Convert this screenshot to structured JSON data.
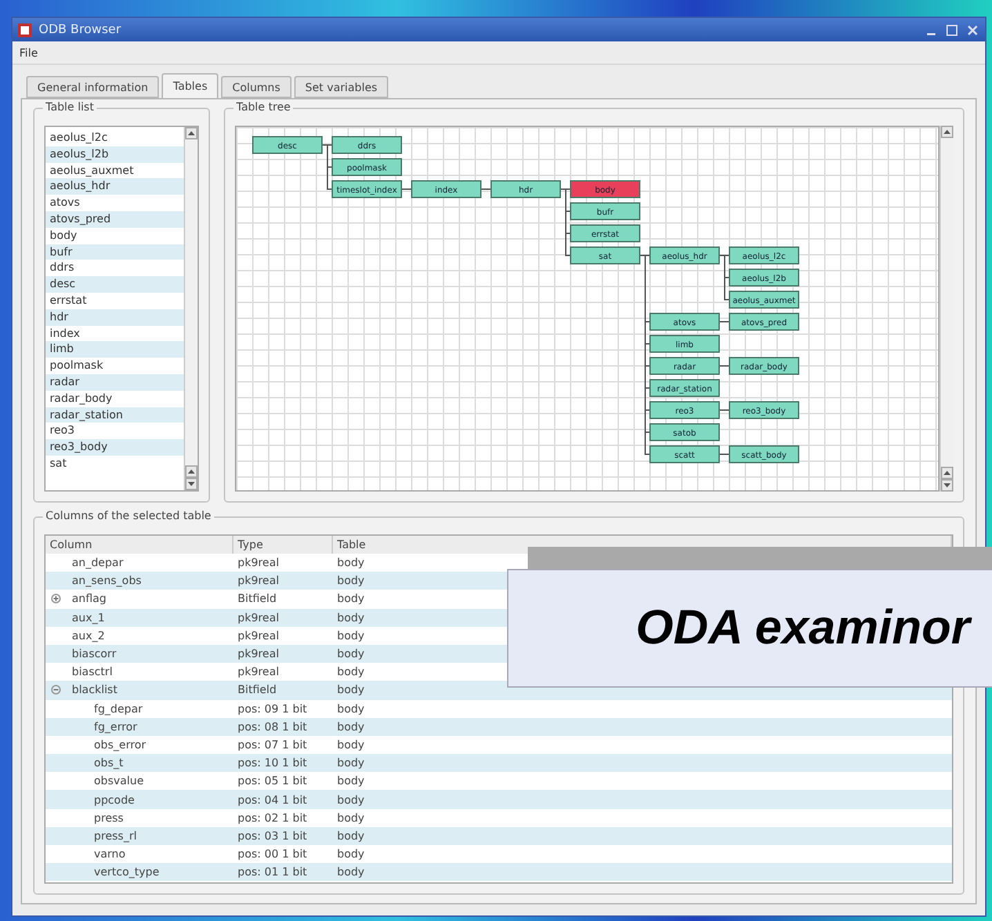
{
  "window": {
    "title": "ODB Browser"
  },
  "menu": [
    "File"
  ],
  "tabs": [
    {
      "label": "General information",
      "selected": false
    },
    {
      "label": "Tables",
      "selected": true
    },
    {
      "label": "Columns",
      "selected": false
    },
    {
      "label": "Set variables",
      "selected": false
    }
  ],
  "table_list": {
    "title": "Table list",
    "items": [
      "aeolus_l2c",
      "aeolus_l2b",
      "aeolus_auxmet",
      "aeolus_hdr",
      "atovs",
      "atovs_pred",
      "body",
      "bufr",
      "ddrs",
      "desc",
      "errstat",
      "hdr",
      "index",
      "limb",
      "poolmask",
      "radar",
      "radar_body",
      "radar_station",
      "reo3",
      "reo3_body",
      "sat"
    ]
  },
  "table_tree": {
    "title": "Table tree",
    "root": {
      "label": "desc",
      "selected": false,
      "children": [
        {
          "label": "ddrs",
          "selected": false
        },
        {
          "label": "poolmask",
          "selected": false
        },
        {
          "label": "timeslot_index",
          "selected": false,
          "children": [
            {
              "label": "index",
              "selected": false,
              "children": [
                {
                  "label": "hdr",
                  "selected": false,
                  "children": [
                    {
                      "label": "body",
                      "selected": true
                    },
                    {
                      "label": "bufr",
                      "selected": false
                    },
                    {
                      "label": "errstat",
                      "selected": false
                    },
                    {
                      "label": "sat",
                      "selected": false,
                      "children": [
                        {
                          "label": "aeolus_hdr",
                          "selected": false,
                          "children": [
                            {
                              "label": "aeolus_l2c",
                              "selected": false
                            },
                            {
                              "label": "aeolus_l2b",
                              "selected": false
                            },
                            {
                              "label": "aeolus_auxmet",
                              "selected": false
                            }
                          ]
                        },
                        {
                          "label": "atovs",
                          "selected": false,
                          "children": [
                            {
                              "label": "atovs_pred",
                              "selected": false
                            }
                          ]
                        },
                        {
                          "label": "limb",
                          "selected": false
                        },
                        {
                          "label": "radar",
                          "selected": false,
                          "children": [
                            {
                              "label": "radar_body",
                              "selected": false
                            }
                          ]
                        },
                        {
                          "label": "radar_station",
                          "selected": false
                        },
                        {
                          "label": "reo3",
                          "selected": false,
                          "children": [
                            {
                              "label": "reo3_body",
                              "selected": false
                            }
                          ]
                        },
                        {
                          "label": "satob",
                          "selected": false
                        },
                        {
                          "label": "scatt",
                          "selected": false,
                          "children": [
                            {
                              "label": "scatt_body",
                              "selected": false
                            }
                          ]
                        }
                      ]
                    }
                  ]
                }
              ]
            }
          ]
        }
      ]
    }
  },
  "columns_table": {
    "title": "Columns of the selected table",
    "columns": [
      "Column",
      "Type",
      "Table"
    ],
    "rows": [
      {
        "column": "an_depar",
        "type": "pk9real",
        "table": "body"
      },
      {
        "column": "an_sens_obs",
        "type": "pk9real",
        "table": "body"
      },
      {
        "column": "anflag",
        "type": "Bitfield",
        "table": "body",
        "expanded": false
      },
      {
        "column": "aux_1",
        "type": "pk9real",
        "table": "body"
      },
      {
        "column": "aux_2",
        "type": "pk9real",
        "table": "body"
      },
      {
        "column": "biascorr",
        "type": "pk9real",
        "table": "body"
      },
      {
        "column": "biasctrl",
        "type": "pk9real",
        "table": "body"
      },
      {
        "column": "blacklist",
        "type": "Bitfield",
        "table": "body",
        "expanded": true,
        "children": [
          {
            "column": "fg_depar",
            "type": "pos: 09  1 bit",
            "table": "body"
          },
          {
            "column": "fg_error",
            "type": "pos: 08  1 bit",
            "table": "body"
          },
          {
            "column": "obs_error",
            "type": "pos: 07  1 bit",
            "table": "body"
          },
          {
            "column": "obs_t",
            "type": "pos: 10  1 bit",
            "table": "body"
          },
          {
            "column": "obsvalue",
            "type": "pos: 05  1 bit",
            "table": "body"
          },
          {
            "column": "ppcode",
            "type": "pos: 04  1 bit",
            "table": "body"
          },
          {
            "column": "press",
            "type": "pos: 02  1 bit",
            "table": "body"
          },
          {
            "column": "press_rl",
            "type": "pos: 03  1 bit",
            "table": "body"
          },
          {
            "column": "varno",
            "type": "pos: 00  1 bit",
            "table": "body"
          },
          {
            "column": "vertco_type",
            "type": "pos: 01  1 bit",
            "table": "body"
          }
        ]
      }
    ]
  },
  "caption": "ODA examinor"
}
